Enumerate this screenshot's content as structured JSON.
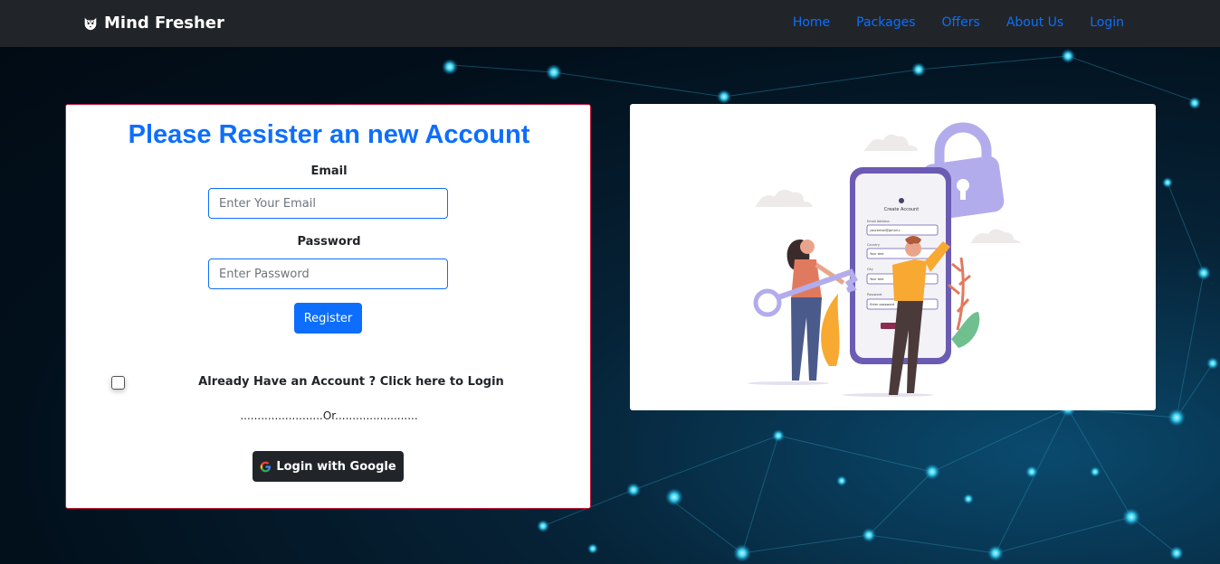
{
  "navbar": {
    "brand": "Mind Fresher",
    "links": [
      "Home",
      "Packages",
      "Offers",
      "About Us",
      "Login"
    ]
  },
  "register": {
    "title": "Please Resister an new Account",
    "email_label": "Email",
    "email_placeholder": "Enter Your Email",
    "password_label": "Password",
    "password_placeholder": "Enter Password",
    "register_button": "Register",
    "login_prompt": "Already Have an Account ? Click here to Login",
    "or_text": "........................Or........................",
    "google_button": "Login with Google"
  },
  "illustration": {
    "phone_title": "Create Account",
    "fields": [
      "Email Address",
      "Country",
      "City",
      "Password"
    ],
    "values": [
      "youremail@gmail.c",
      "Your text",
      "Your text",
      "Enter password"
    ]
  },
  "colors": {
    "accent": "#0d6efd",
    "navbar": "#212529",
    "card_border": "#c2183a"
  }
}
